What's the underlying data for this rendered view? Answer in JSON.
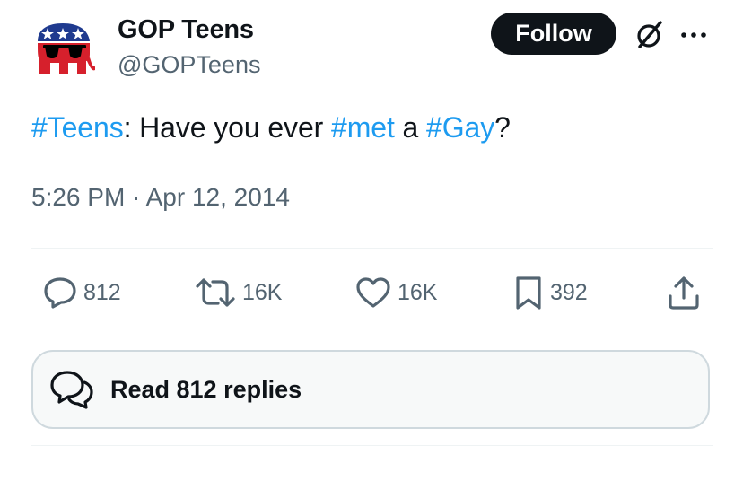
{
  "author": {
    "display_name": "GOP Teens",
    "handle": "@GOPTeens",
    "avatar_icon": "gop-elephant-sunglasses-icon"
  },
  "follow_button_label": "Follow",
  "header_icons": [
    "grok-icon",
    "more-icon"
  ],
  "tweet": {
    "segments": [
      {
        "text": "#Teens",
        "hashtag": true
      },
      {
        "text": ": Have you ever ",
        "hashtag": false
      },
      {
        "text": "#met",
        "hashtag": true
      },
      {
        "text": " a ",
        "hashtag": false
      },
      {
        "text": "#Gay",
        "hashtag": true
      },
      {
        "text": "?",
        "hashtag": false
      }
    ],
    "timestamp": "5:26 PM · Apr 12, 2014"
  },
  "actions": {
    "replies": {
      "icon": "reply-icon",
      "count": "812"
    },
    "reposts": {
      "icon": "repost-icon",
      "count": "16K"
    },
    "likes": {
      "icon": "heart-icon",
      "count": "16K"
    },
    "bookmarks": {
      "icon": "bookmark-icon",
      "count": "392"
    },
    "share": {
      "icon": "share-icon"
    }
  },
  "read_replies_label": "Read 812 replies",
  "colors": {
    "hashtag": "#1d9bf0",
    "text": "#0f1419",
    "secondary": "#536471",
    "follow_bg": "#0f1419",
    "divider": "#eff3f4",
    "elephant_blue": "#1f3a8f",
    "elephant_red": "#d6202c"
  }
}
